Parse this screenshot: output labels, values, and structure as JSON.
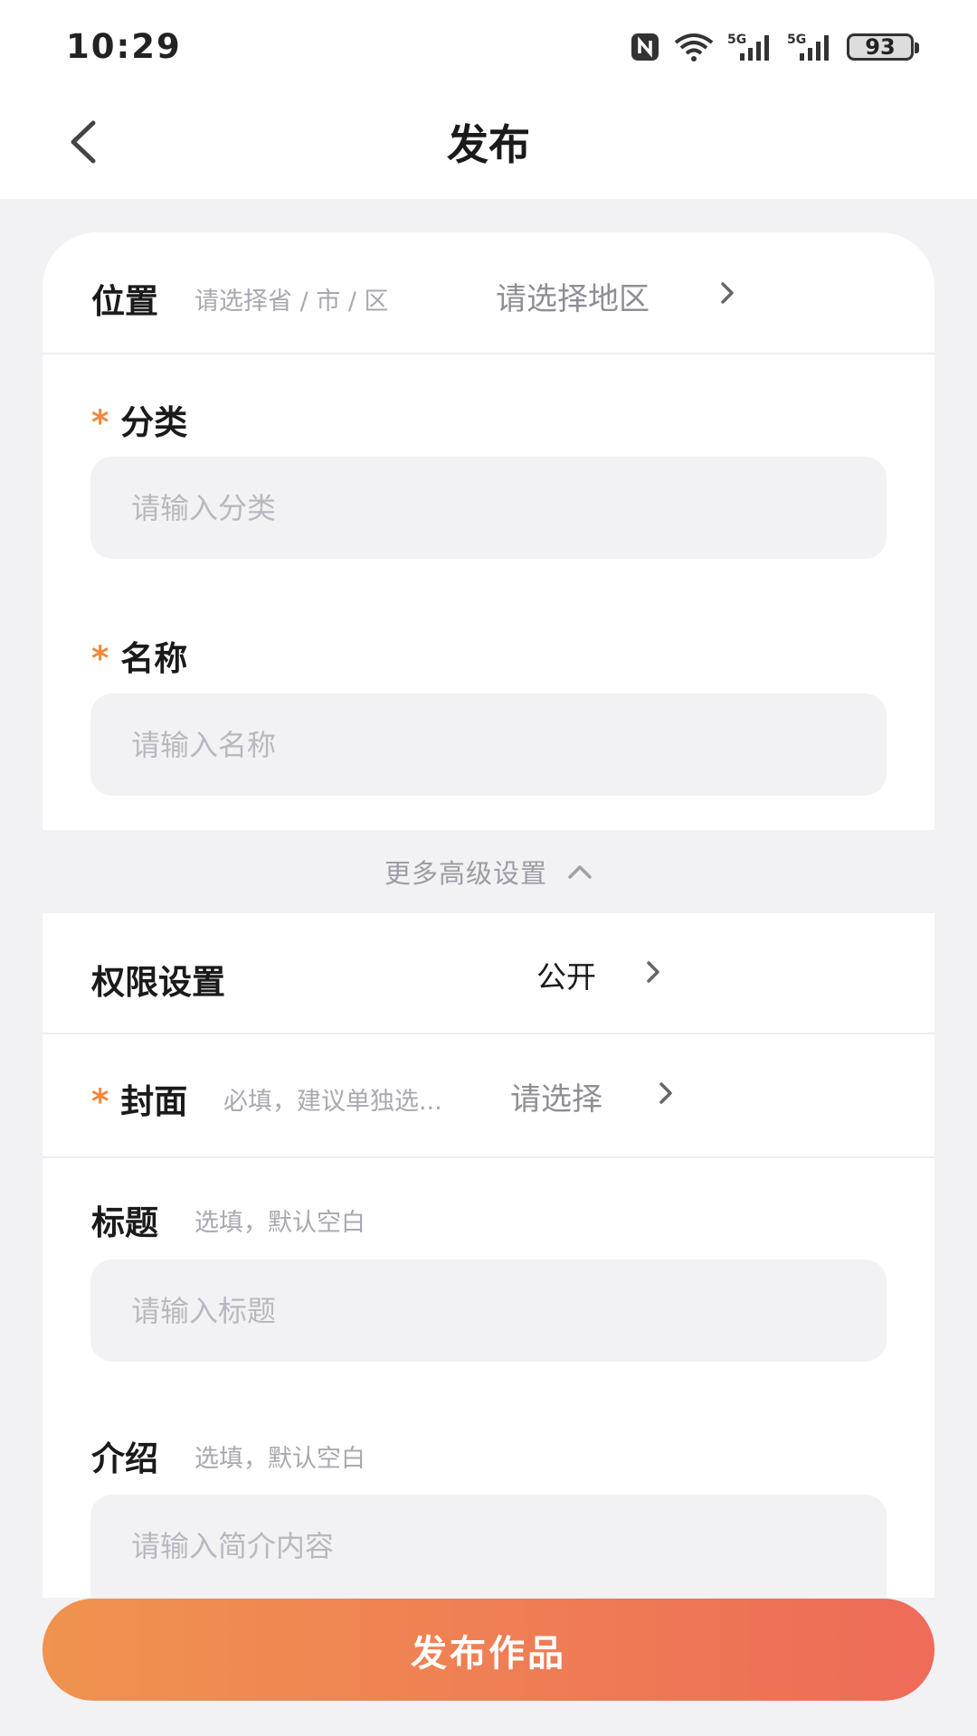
{
  "status_bar": {
    "time": "10:29",
    "battery": "93"
  },
  "header": {
    "title": "发布"
  },
  "form": {
    "location": {
      "label": "位置",
      "hint": "请选择省 / 市 / 区",
      "value": "请选择地区"
    },
    "category": {
      "required_mark": "*",
      "label": "分类",
      "placeholder": "请输入分类"
    },
    "name": {
      "required_mark": "*",
      "label": "名称",
      "placeholder": "请输入名称"
    },
    "advanced": {
      "label": "更多高级设置"
    },
    "permission": {
      "label": "权限设置",
      "value": "公开"
    },
    "cover": {
      "required_mark": "*",
      "label": "封面",
      "hint": "必填，建议单独选...",
      "value": "请选择"
    },
    "title_field": {
      "label": "标题",
      "hint": "选填，默认空白",
      "placeholder": "请输入标题"
    },
    "intro": {
      "label": "介绍",
      "hint": "选填，默认空白",
      "placeholder": "请输入简介内容"
    }
  },
  "footer": {
    "publish_label": "发布作品"
  },
  "colors": {
    "accent_start": "#f0934f",
    "accent_end": "#ee6b58",
    "required": "#f0883e"
  }
}
